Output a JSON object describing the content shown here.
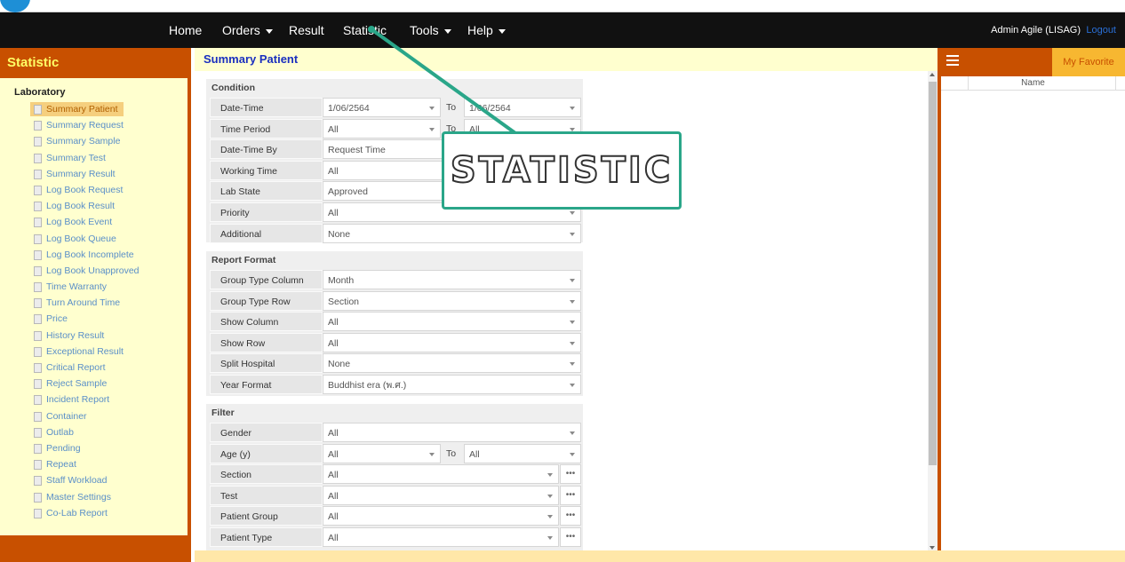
{
  "nav": {
    "items": [
      {
        "label": "Home",
        "dropdown": false
      },
      {
        "label": "Orders",
        "dropdown": true
      },
      {
        "label": "Result",
        "dropdown": false
      },
      {
        "label": "Statistic",
        "dropdown": false
      },
      {
        "label": "Tools",
        "dropdown": true
      },
      {
        "label": "Help",
        "dropdown": true
      }
    ],
    "user": "Admin Agile (LISAG)",
    "logout": "Logout"
  },
  "sidebar": {
    "title": "Statistic",
    "section": "Laboratory",
    "items": [
      "Summary Patient",
      "Summary Request",
      "Summary Sample",
      "Summary Test",
      "Summary Result",
      "Log Book Request",
      "Log Book Result",
      "Log Book Event",
      "Log Book Queue",
      "Log Book Incomplete",
      "Log Book Unapproved",
      "Time Warranty",
      "Turn Around Time",
      "Price",
      "History Result",
      "Exceptional Result",
      "Critical Report",
      "Reject Sample",
      "Incident Report",
      "Container",
      "Outlab",
      "Pending",
      "Repeat",
      "Staff Workload",
      "Master Settings",
      "Co-Lab Report"
    ],
    "active_index": 0
  },
  "main": {
    "title": "Summary Patient",
    "condition": {
      "title": "Condition",
      "date_time": {
        "label": "Date-Time",
        "from": "1/06/2564",
        "to_label": "To",
        "to": "1/06/2564"
      },
      "time_period": {
        "label": "Time Period",
        "from": "All",
        "to_label": "To",
        "to": "All"
      },
      "rows": [
        {
          "label": "Date-Time By",
          "value": "Request Time"
        },
        {
          "label": "Working Time",
          "value": "All"
        },
        {
          "label": "Lab State",
          "value": "Approved"
        },
        {
          "label": "Priority",
          "value": "All"
        },
        {
          "label": "Additional",
          "value": "None"
        }
      ]
    },
    "report_format": {
      "title": "Report Format",
      "rows": [
        {
          "label": "Group Type Column",
          "value": "Month"
        },
        {
          "label": "Group Type Row",
          "value": "Section"
        },
        {
          "label": "Show Column",
          "value": "All"
        },
        {
          "label": "Show Row",
          "value": "All"
        },
        {
          "label": "Split Hospital",
          "value": "None"
        },
        {
          "label": "Year Format",
          "value": "Buddhist era (พ.ศ.)"
        }
      ]
    },
    "filter": {
      "title": "Filter",
      "gender": {
        "label": "Gender",
        "value": "All"
      },
      "age": {
        "label": "Age (y)",
        "from": "All",
        "to_label": "To",
        "to": "All"
      },
      "more_rows": [
        {
          "label": "Section",
          "value": "All",
          "more": "•••"
        },
        {
          "label": "Test",
          "value": "All",
          "more": "•••"
        },
        {
          "label": "Patient Group",
          "value": "All",
          "more": "•••"
        },
        {
          "label": "Patient Type",
          "value": "All",
          "more": "•••"
        }
      ]
    }
  },
  "favorites": {
    "button": "My Favorite",
    "column": "Name"
  },
  "callout": {
    "text": "STATISTIC",
    "color": "#2aa689"
  },
  "colors": {
    "brand": "#c85000",
    "sidebar_bg": "#ffffcf",
    "link": "#5a8fc8",
    "title": "#1a2fbf",
    "favorite": "#f7b731"
  }
}
